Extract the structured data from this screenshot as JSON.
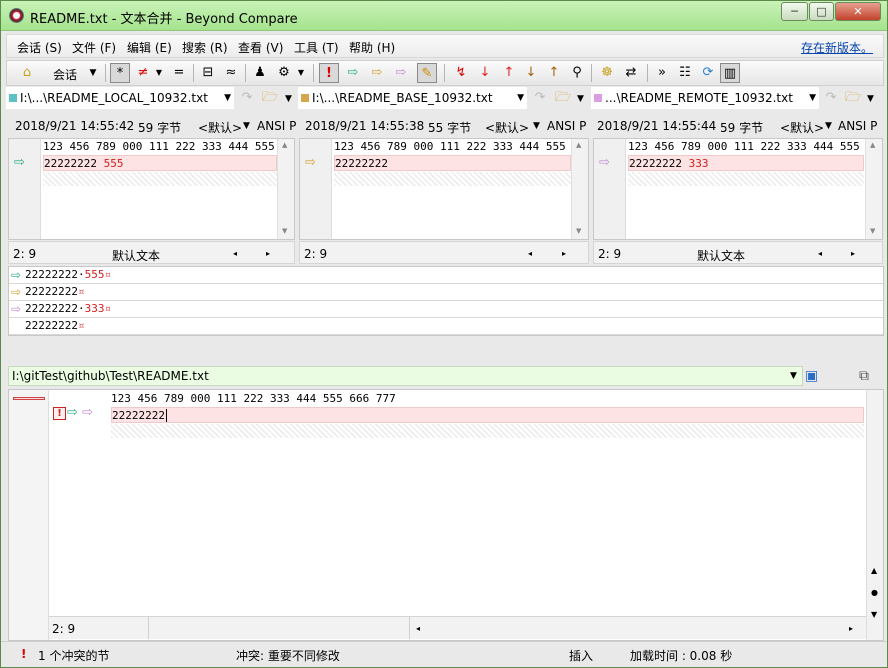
{
  "window": {
    "title": "README.txt - 文本合并 - Beyond Compare",
    "min": "─",
    "max": "□",
    "close": "✕"
  },
  "menu": {
    "items": [
      "会话 (S)",
      "文件 (F)",
      "编辑 (E)",
      "搜索 (R)",
      "查看 (V)",
      "工具 (T)",
      "帮助 (H)"
    ],
    "update_link": "存在新版本。"
  },
  "toolbar": {
    "session_label": "会话"
  },
  "panes": [
    {
      "path": "I:\\...\\README_LOCAL_10932.txt",
      "color": "#5bc3c7",
      "timestamp": "2018/9/21 14:55:42",
      "size": "59 字节",
      "encoding": "<默认>",
      "charset": "ANSI P",
      "line1": "123 456 789 000 111 222 333 444 555",
      "line2_prefix": "22222222",
      "line2_diff": " 555",
      "arrow_color": "#2bab8a",
      "position": "2: 9",
      "format": "默认文本"
    },
    {
      "path": "I:\\...\\README_BASE_10932.txt",
      "color": "#d6a64b",
      "timestamp": "2018/9/21 14:55:38",
      "size": "55 字节",
      "encoding": "<默认>",
      "charset": "ANSI P",
      "line1": "123 456 789 000 111 222 333 444 555",
      "line2_prefix": "22222222",
      "line2_diff": "",
      "arrow_color": "#d6a23b",
      "position": "2: 9",
      "format": ""
    },
    {
      "path": "...\\README_REMOTE_10932.txt",
      "color": "#dc9ee3",
      "timestamp": "2018/9/21 14:55:44",
      "size": "59 字节",
      "encoding": "<默认>",
      "charset": "ANSI P",
      "line1": "123 456 789 000 111 222 333 444 555",
      "line2_prefix": "22222222",
      "line2_diff": " 333",
      "arrow_color": "#c98bd4",
      "position": "2: 9",
      "format": "默认文本"
    }
  ],
  "summary": {
    "rows": [
      {
        "text": "22222222·",
        "diff": "555",
        "end": "¤",
        "arrow": "#2bab8a"
      },
      {
        "text": "22222222",
        "diff": "",
        "end": "¤",
        "arrow": "#d6a23b"
      },
      {
        "text": "22222222·",
        "diff": "333",
        "end": "¤",
        "arrow": "#c98bd4"
      },
      {
        "text": "22222222",
        "diff": "",
        "end": "¤",
        "arrow": ""
      }
    ]
  },
  "output": {
    "path": "I:\\gitTest\\github\\Test\\README.txt",
    "line1": "123 456 789 000 111 222 333 444 555 666 777",
    "line2": "22222222",
    "position": "2: 9"
  },
  "statusbar": {
    "conflicts": "1 个冲突的节",
    "conflict_desc": "冲突: 重要不同修改",
    "mode": "插入",
    "load_time": "加载时间 : 0.08 秒"
  }
}
